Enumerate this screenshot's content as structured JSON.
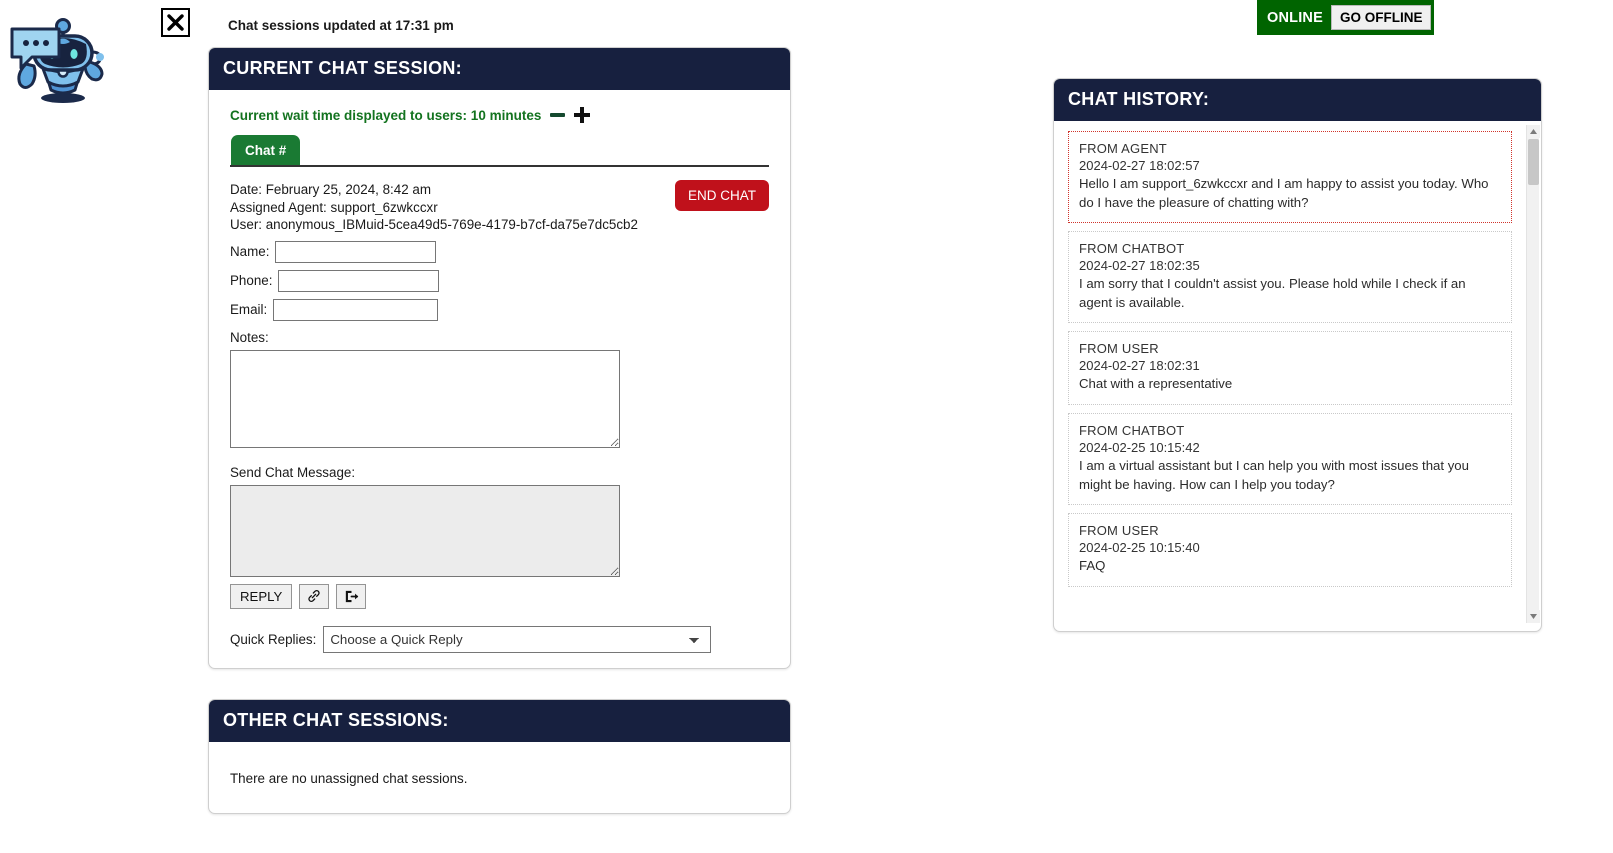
{
  "status": {
    "online_label": "ONLINE",
    "go_offline_label": "GO OFFLINE",
    "online_color": "#006400"
  },
  "header": {
    "updated_text": "Chat sessions updated at 17:31 pm"
  },
  "current_session": {
    "title": "CURRENT CHAT SESSION:",
    "wait_time_text": "Current wait time displayed to users: 10 minutes",
    "tab_label": "Chat #",
    "end_chat_label": "END CHAT",
    "date_line": "Date: February 25, 2024, 8:42 am",
    "agent_line": "Assigned Agent: support_6zwkccxr",
    "user_line": "User: anonymous_IBMuid-5cea49d5-769e-4179-b7cf-da75e7dc5cb2",
    "name_label": "Name:",
    "name_value": "",
    "phone_label": "Phone:",
    "phone_value": "",
    "email_label": "Email:",
    "email_value": "",
    "notes_label": "Notes:",
    "notes_value": "",
    "send_label": "Send Chat Message:",
    "send_value": "",
    "reply_label": "REPLY",
    "quick_replies_label": "Quick Replies:",
    "quick_replies_selected": "Choose a Quick Reply"
  },
  "other_sessions": {
    "title": "OTHER CHAT SESSIONS:",
    "empty_text": "There are no unassigned chat sessions."
  },
  "chat_history": {
    "title": "CHAT HISTORY:",
    "messages": [
      {
        "from": "FROM AGENT",
        "time": "2024-02-27 18:02:57",
        "text": "Hello I am support_6zwkccxr and I am happy to assist you today. Who do I have the pleasure of chatting with?",
        "highlight": true
      },
      {
        "from": "FROM CHATBOT",
        "time": "2024-02-27 18:02:35",
        "text": "I am sorry that I couldn't assist you. Please hold while I check if an agent is available.",
        "highlight": false
      },
      {
        "from": "FROM USER",
        "time": "2024-02-27 18:02:31",
        "text": "Chat with a representative",
        "highlight": false
      },
      {
        "from": "FROM CHATBOT",
        "time": "2024-02-25 10:15:42",
        "text": "I am a virtual assistant but I can help you with most issues that you might be having. How can I help you today?",
        "highlight": false
      },
      {
        "from": "FROM USER",
        "time": "2024-02-25 10:15:40",
        "text": "FAQ",
        "highlight": false
      }
    ]
  }
}
